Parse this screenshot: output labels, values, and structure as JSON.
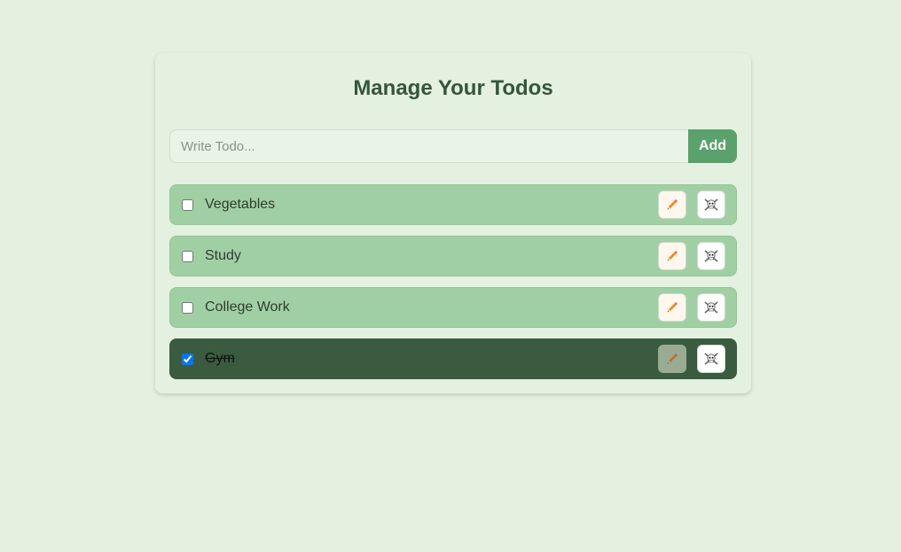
{
  "page": {
    "title": "Manage Your Todos"
  },
  "form": {
    "input_value": "",
    "input_placeholder": "Write Todo...",
    "add_label": "Add"
  },
  "todos": [
    {
      "text": "Vegetables",
      "completed": false,
      "edit_icon": "pencil-icon",
      "delete_icon": "skull-crossbones-icon"
    },
    {
      "text": "Study",
      "completed": false,
      "edit_icon": "pencil-icon",
      "delete_icon": "skull-crossbones-icon"
    },
    {
      "text": "College Work",
      "completed": false,
      "edit_icon": "pencil-icon",
      "delete_icon": "skull-crossbones-icon"
    },
    {
      "text": "Gym",
      "completed": true,
      "edit_icon": "pencil-icon",
      "delete_icon": "skull-crossbones-icon"
    }
  ],
  "colors": {
    "background": "#e4f0e0",
    "title": "#35563a",
    "accent": "#5ba16c",
    "todo_pending": "#a1cfa4",
    "todo_done": "#3a5b3f"
  }
}
